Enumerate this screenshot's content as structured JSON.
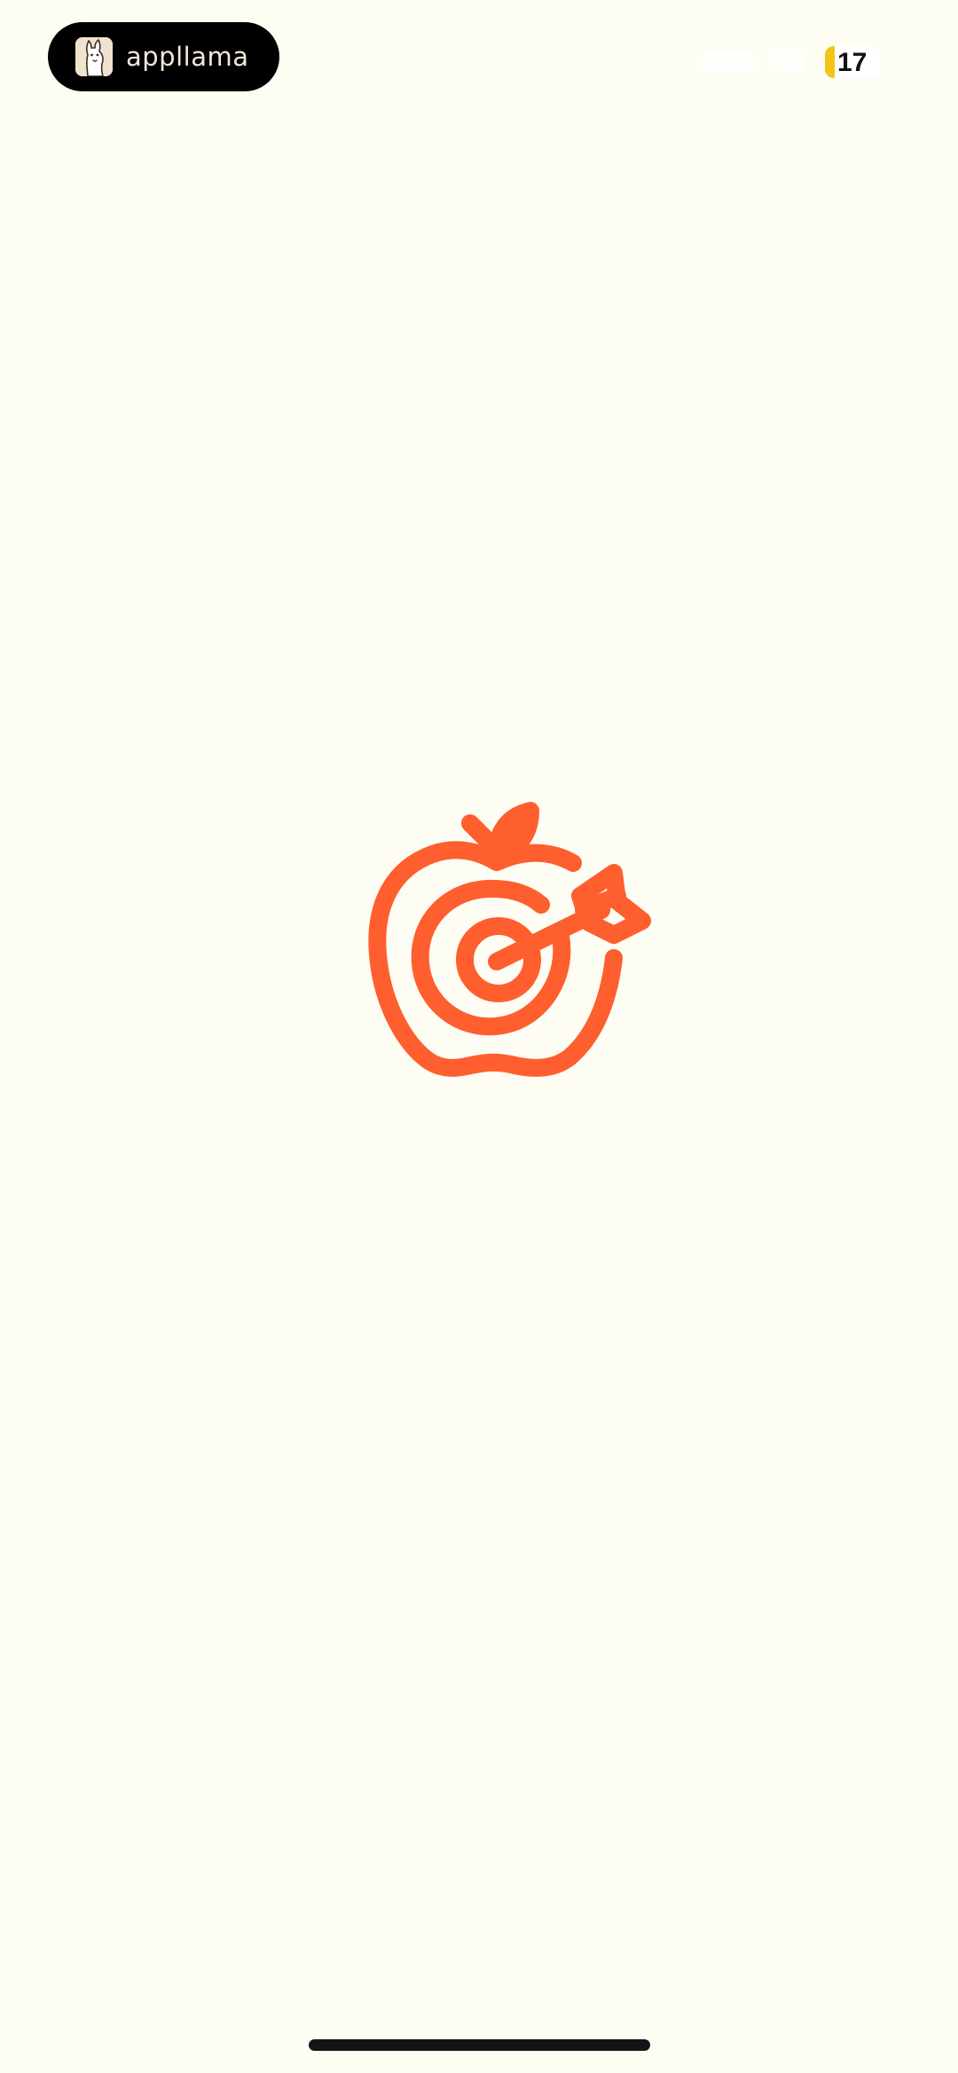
{
  "status_bar": {
    "app_pill_label": "appllama",
    "app_pill_icon": "llama-icon",
    "battery_level": "17",
    "battery_percent": 17,
    "battery_color": "#F4C419"
  },
  "splash": {
    "logo_icon": "apple-target-arrow-icon",
    "logo_color": "#FF5E2E",
    "background_color": "#FEFDF3"
  },
  "home_indicator": {
    "color": "#141414"
  }
}
